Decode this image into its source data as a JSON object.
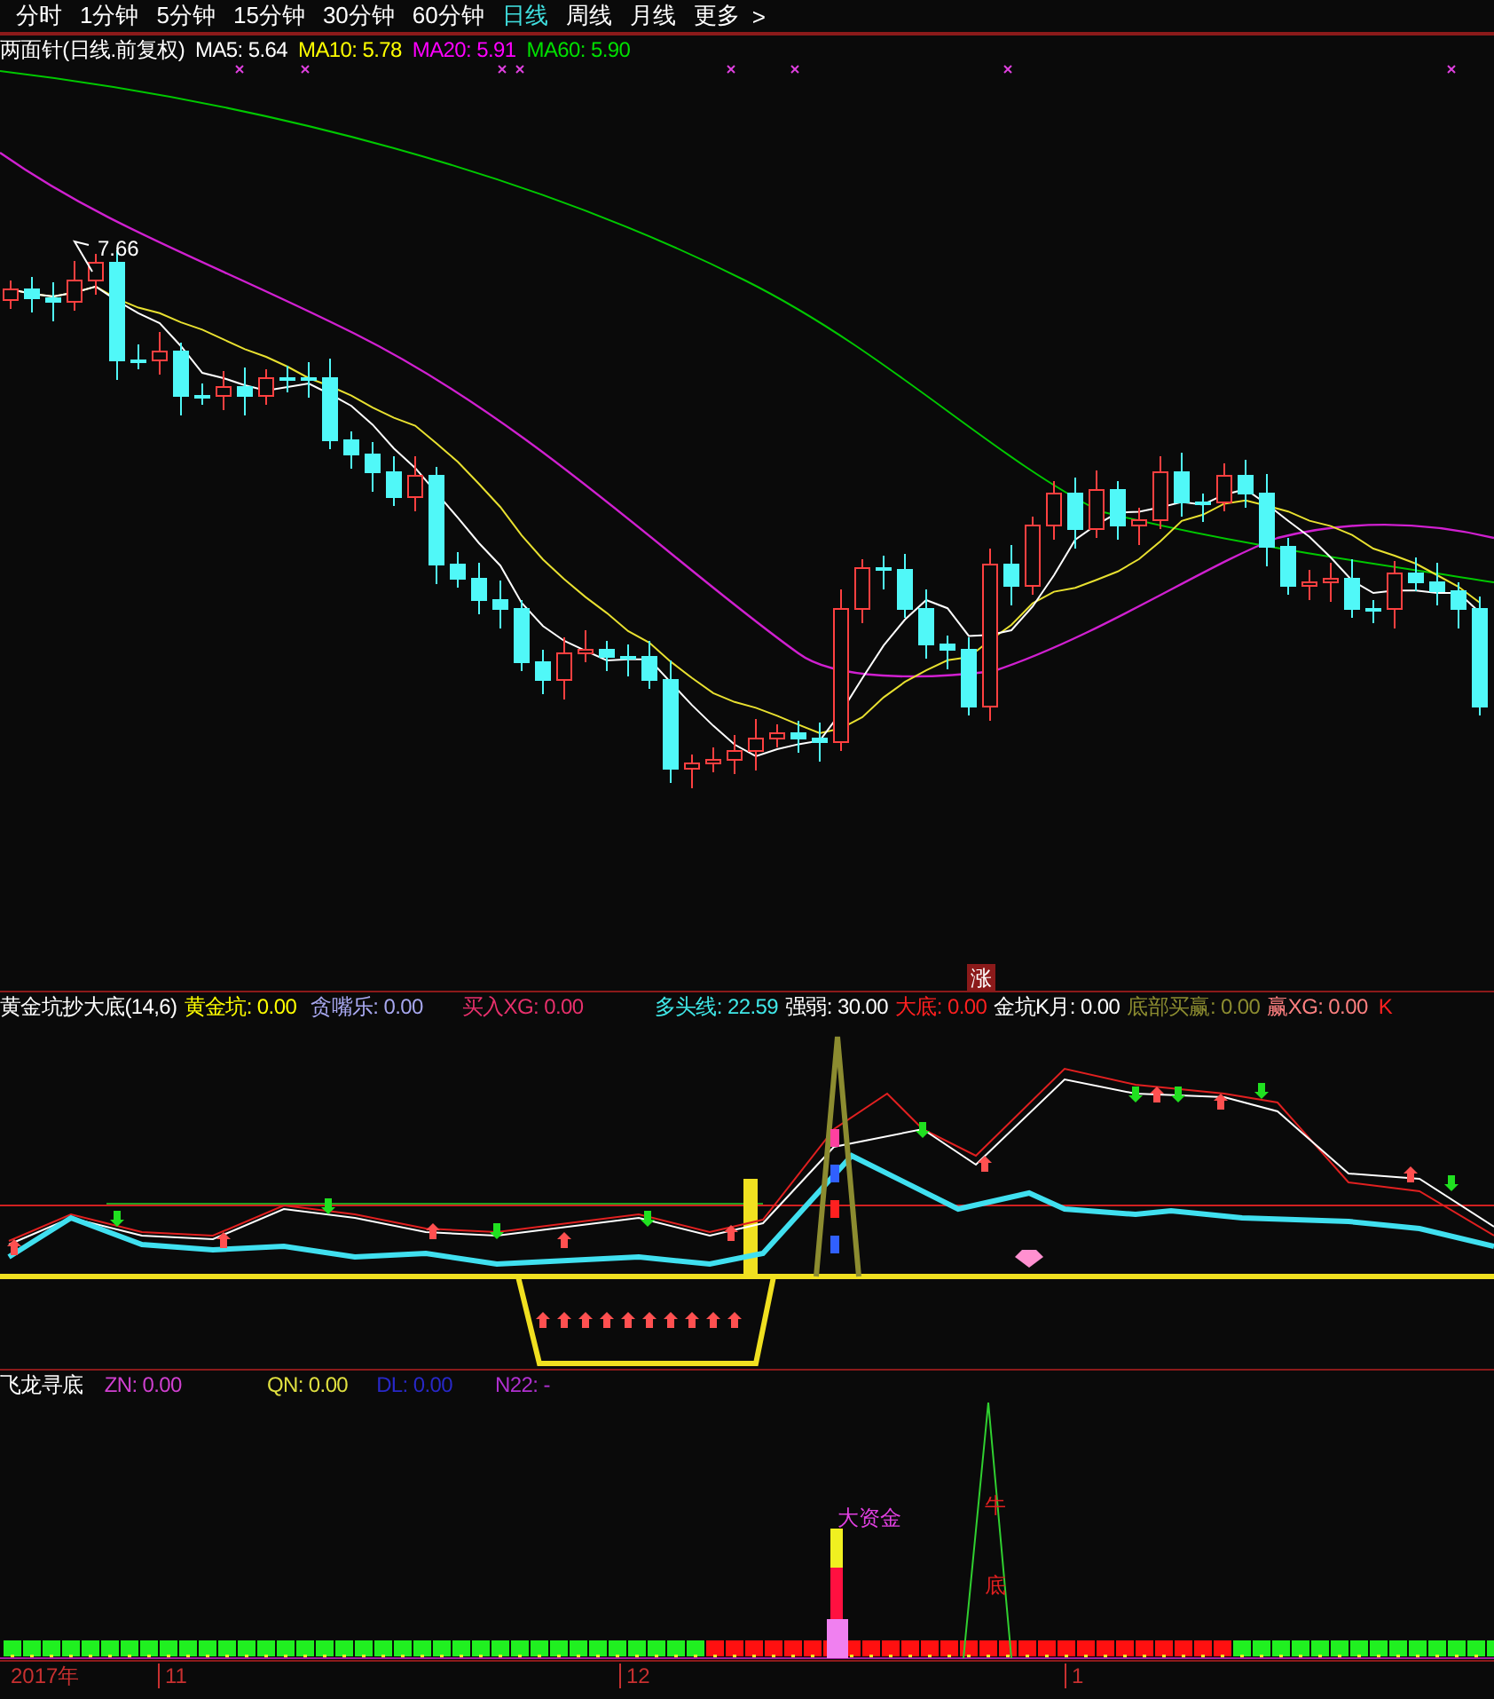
{
  "period_tabs": [
    {
      "label": "分时",
      "selected": false
    },
    {
      "label": "1分钟",
      "selected": false
    },
    {
      "label": "5分钟",
      "selected": false
    },
    {
      "label": "15分钟",
      "selected": false
    },
    {
      "label": "30分钟",
      "selected": false
    },
    {
      "label": "60分钟",
      "selected": false
    },
    {
      "label": "日线",
      "selected": true
    },
    {
      "label": "周线",
      "selected": false
    },
    {
      "label": "月线",
      "selected": false
    },
    {
      "label": "更多",
      "selected": false
    }
  ],
  "more_arrow": ">",
  "price_panel": {
    "title": "两面针(日线.前复权)",
    "legend": [
      {
        "label": "MA5: 5.64",
        "color": "#ffffff"
      },
      {
        "label": "MA10: 5.78",
        "color": "#ffff00"
      },
      {
        "label": "MA20: 5.91",
        "color": "#ff00ff"
      },
      {
        "label": "MA60: 5.90",
        "color": "#00e000"
      }
    ],
    "high_label": "7.66"
  },
  "indicator_panel": {
    "title": "黄金坑抄大底(14,6)",
    "legend": [
      {
        "label": "黄金坑: 0.00",
        "color": "#ffff00"
      },
      {
        "label": "贪嘴乐: 0.00",
        "color": "#a8a8f0"
      },
      {
        "label": "买入XG: 0.00",
        "color": "#e8306c"
      },
      {
        "label": "多头线: 22.59",
        "color": "#40e8e8"
      },
      {
        "label": "强弱: 30.00",
        "color": "#ffffff"
      },
      {
        "label": "大底: 0.00",
        "color": "#ff2020"
      },
      {
        "label": "金坑K月: 0.00",
        "color": "#ffffff"
      },
      {
        "label": "底部买赢: 0.00",
        "color": "#8c8c30"
      },
      {
        "label": "赢XG: 0.00",
        "color": "#ff8080"
      },
      {
        "label": "K",
        "color": "#ff2020"
      }
    ],
    "badge": "涨"
  },
  "dragon_panel": {
    "title": "飞龙寻底",
    "legend": [
      {
        "label": "ZN: 0.00",
        "color": "#d040d0"
      },
      {
        "label": "QN: 0.00",
        "color": "#e0e040"
      },
      {
        "label": "DL: 0.00",
        "color": "#2828c8"
      },
      {
        "label": "N22: -",
        "color": "#b030d0"
      }
    ],
    "fund_label": "大资金",
    "bull_label": "牛",
    "bottom_label": "底"
  },
  "time_axis": [
    "2017年",
    "11",
    "12",
    "1"
  ]
}
